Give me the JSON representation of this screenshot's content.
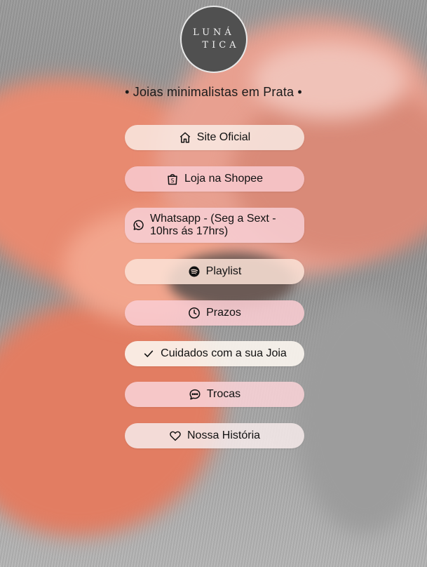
{
  "logo": {
    "line1": "LUNÁ",
    "line2": "TICA"
  },
  "tagline": "• Joias minimalistas em Prata •",
  "links": {
    "site": {
      "label": "Site Oficial",
      "icon": "home-icon"
    },
    "shopee": {
      "label": "Loja na Shopee",
      "icon": "shopping-bag-icon"
    },
    "whatsapp": {
      "label": "Whatsapp - (Seg a Sext - 10hrs ás 17hrs)",
      "icon": "whatsapp-icon"
    },
    "playlist": {
      "label": "Playlist",
      "icon": "spotify-icon"
    },
    "prazos": {
      "label": "Prazos",
      "icon": "clock-icon"
    },
    "cuidados": {
      "label": "Cuidados com a sua Joia",
      "icon": "check-icon"
    },
    "trocas": {
      "label": "Trocas",
      "icon": "chat-bubble-icon"
    },
    "historia": {
      "label": "Nossa História",
      "icon": "heart-icon"
    }
  }
}
